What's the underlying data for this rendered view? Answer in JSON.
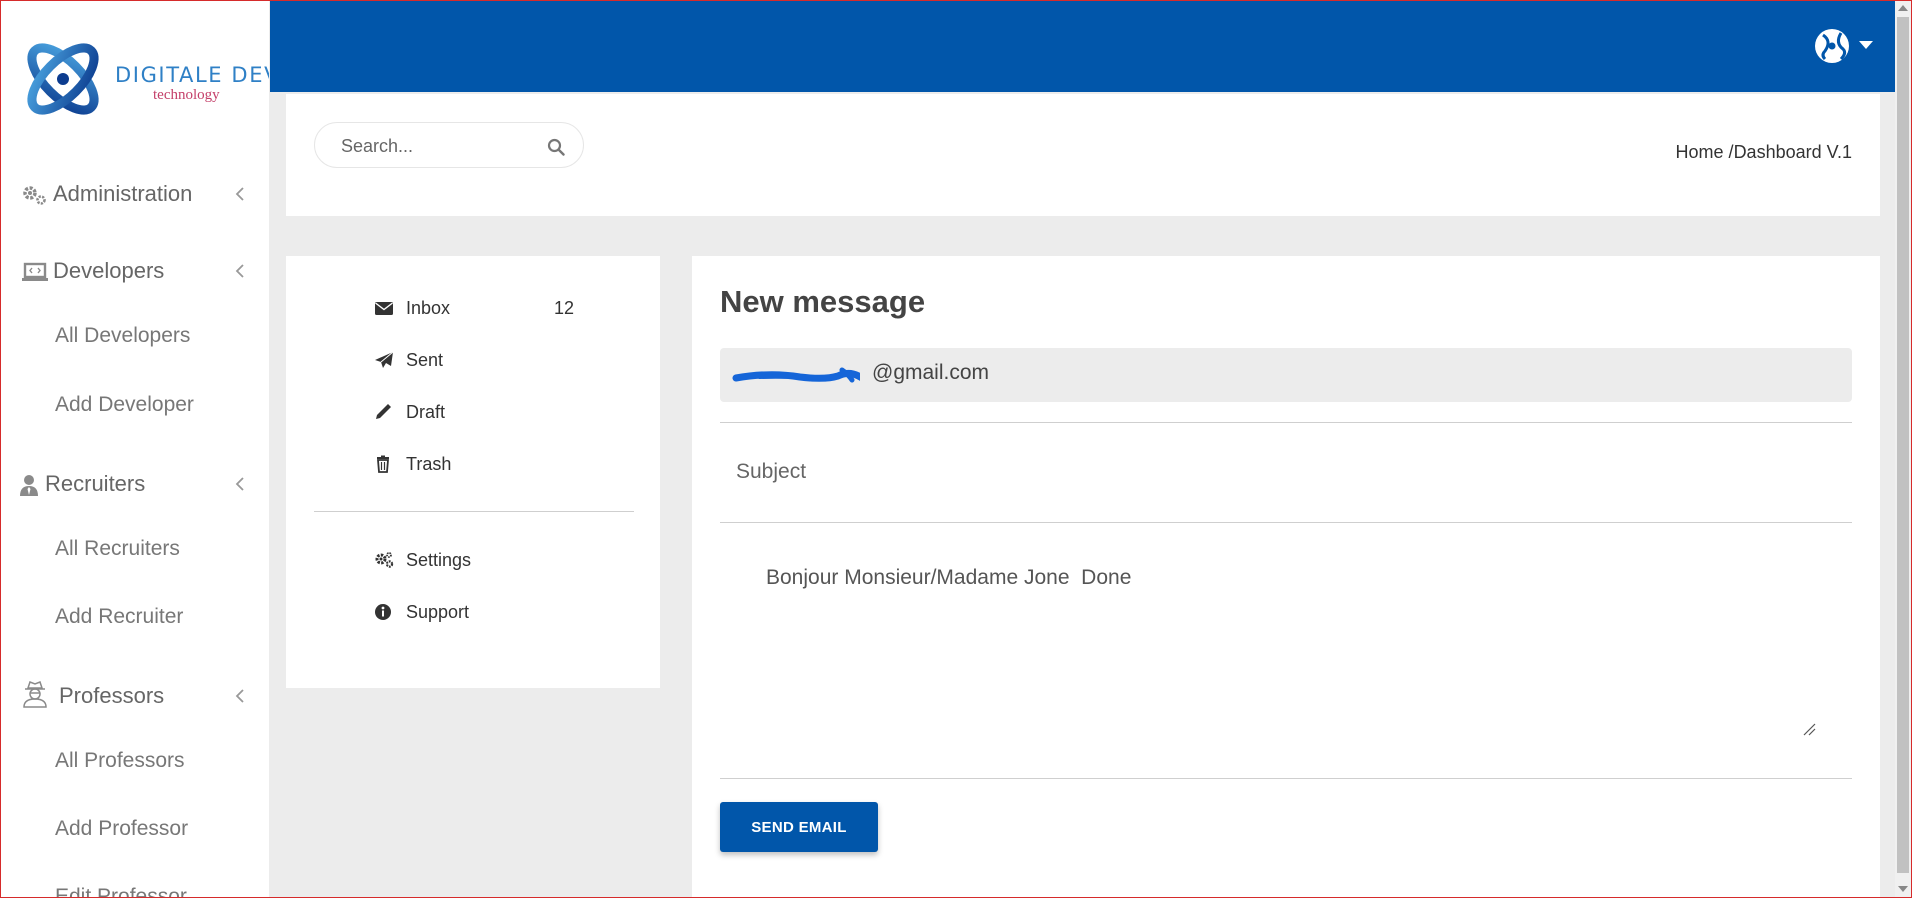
{
  "brand": {
    "title": "DIGITALE DEV",
    "subtitle": "technology"
  },
  "sidebar": {
    "sections": [
      {
        "label": "Administration",
        "icon": "gears-icon"
      },
      {
        "label": "Developers",
        "icon": "laptop-code-icon"
      },
      {
        "label": "Recruiters",
        "icon": "user-tie-icon"
      },
      {
        "label": "Professors",
        "icon": "user-secret-icon"
      }
    ],
    "developers_sub": [
      "All Developers",
      "Add Developer"
    ],
    "recruiters_sub": [
      "All Recruiters",
      "Add Recruiter"
    ],
    "professors_sub": [
      "All Professors",
      "Add Professor",
      "Edit Professor"
    ]
  },
  "header": {
    "search_placeholder": "Search...",
    "breadcrumb_home": "Home",
    "breadcrumb_sep": " /",
    "breadcrumb_current": "Dashboard V.1"
  },
  "folders": {
    "items": [
      {
        "label": "Inbox",
        "icon": "envelope-icon",
        "count": "12"
      },
      {
        "label": "Sent",
        "icon": "paper-plane-icon"
      },
      {
        "label": "Draft",
        "icon": "pencil-icon"
      },
      {
        "label": "Trash",
        "icon": "trash-icon"
      }
    ],
    "extras": [
      {
        "label": "Settings",
        "icon": "gears-icon"
      },
      {
        "label": "Support",
        "icon": "info-circle-icon"
      }
    ]
  },
  "compose": {
    "title": "New message",
    "to_value": "@gmail.com",
    "subject_placeholder": "Subject",
    "body_value": "Bonjour Monsieur/Madame Jone  Done",
    "send_label": "SEND EMAIL"
  },
  "colors": {
    "primary": "#0156aa",
    "background": "#ececec",
    "logo_blue": "#2f80c6",
    "logo_pink": "#c4406a"
  }
}
